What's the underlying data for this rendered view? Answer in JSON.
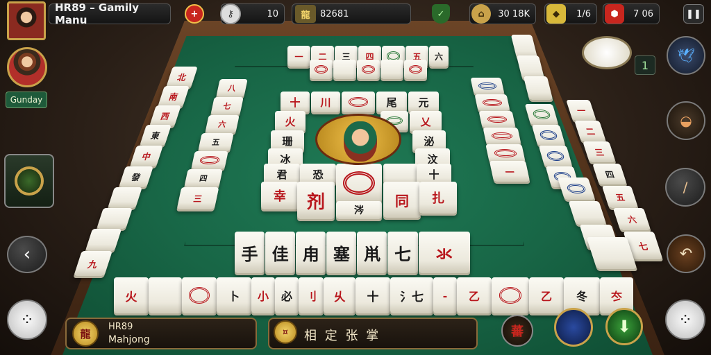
{
  "header": {
    "title": "HR89 – Gamily Manu",
    "player_level": "10",
    "score": "82681",
    "currency_a": "30 18K",
    "currency_b": "1/6",
    "currency_c": "7 06"
  },
  "left": {
    "player_name_tag": "Gunday"
  },
  "table": {
    "counter_badge": "1"
  },
  "hand_tiles": [
    "手",
    "佳",
    "甪",
    "塞",
    "鼡",
    "七",
    "氺"
  ],
  "bottom": {
    "player_id": "HR89",
    "player_game": "Mahjong",
    "action_tiles": "相 定 张 掌"
  },
  "colors": {
    "felt": "#186646",
    "wood": "#5a3820",
    "accent_gold": "#c9a24a",
    "tile_red": "#b8161c"
  },
  "icons": {
    "add": "plus-icon",
    "level": "key-icon",
    "score_badge": "dragon-icon",
    "shield": "shield-icon",
    "home": "house-icon",
    "gem": "gem-icon",
    "ruby": "ruby-icon",
    "exit": "pause-icon"
  }
}
